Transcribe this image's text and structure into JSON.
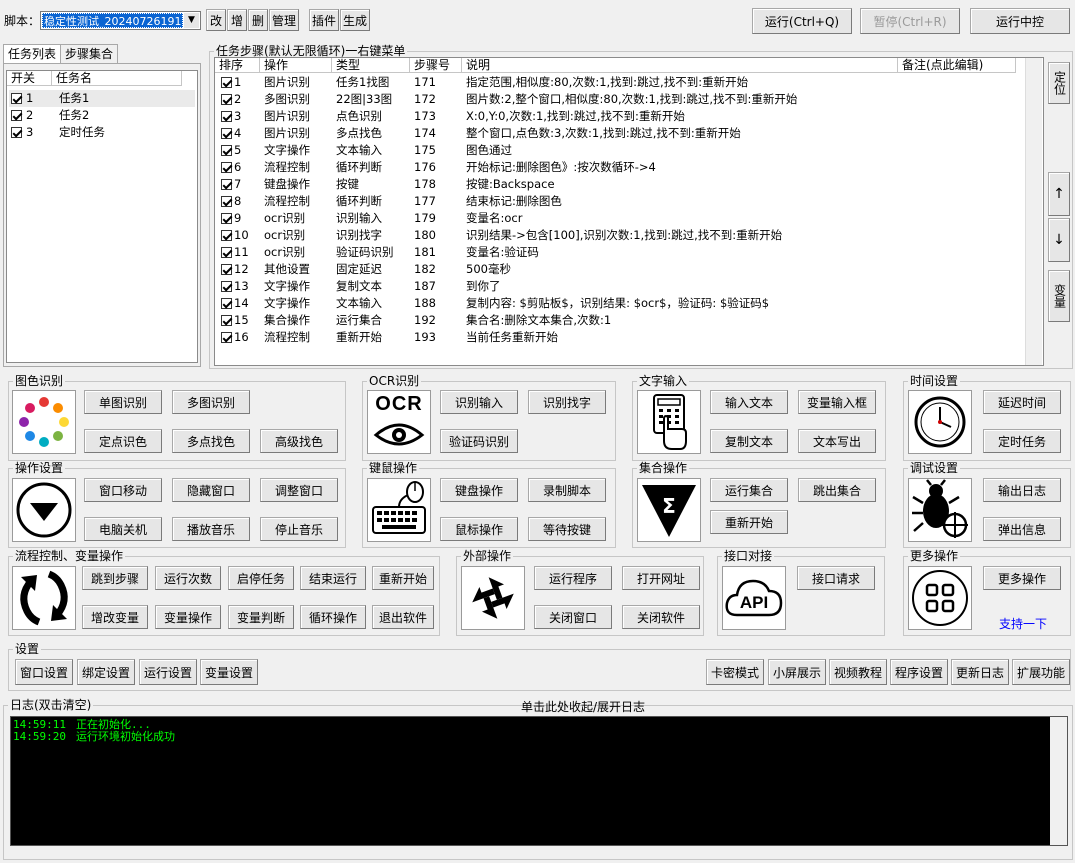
{
  "top": {
    "script_label": "脚本：",
    "script_selected": "稳定性测试_20240726191",
    "btn_change": "改",
    "btn_add": "增",
    "btn_delete": "删",
    "btn_manage": "管理",
    "btn_plugin": "插件",
    "btn_generate": "生成",
    "run": "运行(Ctrl+Q)",
    "pause": "暂停(Ctrl+R)",
    "run_mid": "运行中控"
  },
  "tabs": {
    "task_list": "任务列表",
    "step_set": "步骤集合"
  },
  "task_list": {
    "headers": [
      "开关",
      "任务名"
    ],
    "items": [
      {
        "id": "1",
        "name": "任务1"
      },
      {
        "id": "2",
        "name": "任务2"
      },
      {
        "id": "3",
        "name": "定时任务"
      }
    ]
  },
  "steps": {
    "title": "任务步骤(默认无限循环)一右键菜单",
    "headers": [
      "排序",
      "操作",
      "类型",
      "步骤号",
      "说明",
      "备注(点此编辑)"
    ],
    "rows": [
      [
        "1",
        "图片识别",
        "任务1找图",
        "171",
        "指定范围,相似度:80,次数:1,找到:跳过,找不到:重新开始"
      ],
      [
        "2",
        "多图识别",
        "22图|33图",
        "172",
        "图片数:2,整个窗口,相似度:80,次数:1,找到:跳过,找不到:重新开始"
      ],
      [
        "3",
        "图片识别",
        "点色识别",
        "173",
        "X:0,Y:0,次数:1,找到:跳过,找不到:重新开始"
      ],
      [
        "4",
        "图片识别",
        "多点找色",
        "174",
        "整个窗口,点色数:3,次数:1,找到:跳过,找不到:重新开始"
      ],
      [
        "5",
        "文字操作",
        "文本输入",
        "175",
        "图色通过"
      ],
      [
        "6",
        "流程控制",
        "循环判断",
        "176",
        "开始标记:删除图色》:按次数循环->4"
      ],
      [
        "7",
        "键盘操作",
        "按键",
        "178",
        "按键:Backspace"
      ],
      [
        "8",
        "流程控制",
        "循环判断",
        "177",
        "结束标记:删除图色"
      ],
      [
        "9",
        "ocr识别",
        "识别输入",
        "179",
        "变量名:ocr"
      ],
      [
        "10",
        "ocr识别",
        "识别找字",
        "180",
        "识别结果->包含[100],识别次数:1,找到:跳过,找不到:重新开始"
      ],
      [
        "11",
        "ocr识别",
        "验证码识别",
        "181",
        "变量名:验证码"
      ],
      [
        "12",
        "其他设置",
        "固定延迟",
        "182",
        "500毫秒"
      ],
      [
        "13",
        "文字操作",
        "复制文本",
        "187",
        "到你了"
      ],
      [
        "14",
        "文字操作",
        "文本输入",
        "188",
        "复制内容: $剪贴板$，识别结果: $ocr$，验证码: $验证码$"
      ],
      [
        "15",
        "集合操作",
        "运行集合",
        "192",
        "集合名:删除文本集合,次数:1"
      ],
      [
        "16",
        "流程控制",
        "重新开始",
        "193",
        "当前任务重新开始"
      ]
    ]
  },
  "side": {
    "locate": "定位",
    "up": "↑",
    "down": "↓",
    "variable": "变量"
  },
  "groups": {
    "color": {
      "title": "图色识别",
      "b1": "单图识别",
      "b2": "多图识别",
      "b3": "定点识色",
      "b4": "多点找色",
      "b5": "高级找色"
    },
    "ocr": {
      "title": "OCR识别",
      "icon_text": "OCR",
      "b1": "识别输入",
      "b2": "识别找字",
      "b3": "验证码识别"
    },
    "text": {
      "title": "文字输入",
      "b1": "输入文本",
      "b2": "变量输入框",
      "b3": "复制文本",
      "b4": "文本写出"
    },
    "time": {
      "title": "时间设置",
      "b1": "延迟时间",
      "b2": "定时任务"
    },
    "op": {
      "title": "操作设置",
      "b1": "窗口移动",
      "b2": "隐藏窗口",
      "b3": "调整窗口",
      "b4": "电脑关机",
      "b5": "播放音乐",
      "b6": "停止音乐"
    },
    "km": {
      "title": "键鼠操作",
      "b1": "键盘操作",
      "b2": "录制脚本",
      "b3": "鼠标操作",
      "b4": "等待按键"
    },
    "set": {
      "title": "集合操作",
      "b1": "运行集合",
      "b2": "跳出集合",
      "b3": "重新开始"
    },
    "debug": {
      "title": "调试设置",
      "b1": "输出日志",
      "b2": "弹出信息"
    },
    "flow": {
      "title": "流程控制、变量操作",
      "b1": "跳到步骤",
      "b2": "运行次数",
      "b3": "启停任务",
      "b4": "结束运行",
      "b5": "重新开始",
      "b6": "增改变量",
      "b7": "变量操作",
      "b8": "变量判断",
      "b9": "循环操作",
      "b10": "退出软件"
    },
    "ext": {
      "title": "外部操作",
      "b1": "运行程序",
      "b2": "打开网址",
      "b3": "关闭窗口",
      "b4": "关闭软件"
    },
    "api": {
      "title": "接口对接",
      "icon_text": "API",
      "b1": "接口请求"
    },
    "more": {
      "title": "更多操作",
      "b1": "更多操作",
      "support": "支持一下"
    }
  },
  "settings": {
    "title": "设置",
    "b1": "窗口设置",
    "b2": "绑定设置",
    "b3": "运行设置",
    "b4": "变量设置",
    "r1": "卡密模式",
    "r2": "小屏展示",
    "r3": "视频教程",
    "r4": "程序设置",
    "r5": "更新日志",
    "r6": "扩展功能"
  },
  "log": {
    "title": "日志(双击清空)",
    "toggle": "单击此处收起/展开日志",
    "lines": [
      {
        "time": "14:59:11",
        "msg": "正在初始化..."
      },
      {
        "time": "14:59:20",
        "msg": "运行环境初始化成功"
      }
    ]
  },
  "colors": {
    "log_bg": "#000000",
    "log_text": "#00ff00",
    "select_bg": "#0a64d2",
    "support_link": "#0000ff"
  }
}
